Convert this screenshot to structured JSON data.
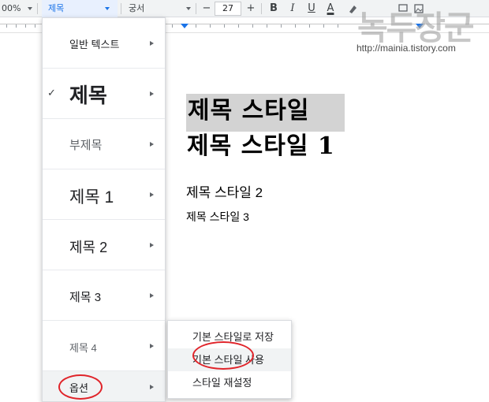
{
  "toolbar": {
    "zoom": "00%",
    "style_select": "제목",
    "font_select": "궁서",
    "font_size": "27",
    "minus_label": "−",
    "plus_label": "+",
    "bold_label": "B",
    "italic_label": "I",
    "underline_label": "U",
    "text_color_label": "A",
    "colors": {
      "accent": "#1a73e8",
      "selected_bg": "#e8f0fe"
    }
  },
  "style_menu": {
    "items": [
      {
        "label": "일반 텍스트",
        "checked": false
      },
      {
        "label": "제목",
        "checked": true
      },
      {
        "label": "부제목",
        "checked": false
      },
      {
        "label": "제목 1",
        "checked": false
      },
      {
        "label": "제목 2",
        "checked": false
      },
      {
        "label": "제목 3",
        "checked": false
      },
      {
        "label": "제목 4",
        "checked": false
      },
      {
        "label": "옵션",
        "checked": false
      }
    ],
    "check_mark": "✓"
  },
  "options_submenu": {
    "items": [
      {
        "label": "기본 스타일로 저장"
      },
      {
        "label": "기본 스타일 사용",
        "hovered": true
      },
      {
        "label": "스타일 재설정"
      }
    ]
  },
  "document": {
    "title": "제목 스타일",
    "heading1": "제목 스타일 1",
    "heading2": "제목 스타일 2",
    "heading3": "제목 스타일 3"
  },
  "watermark": {
    "brand": "녹두장군",
    "url": "http://mainia.tistory.com"
  },
  "annotations": {
    "color": "#e0242a"
  }
}
